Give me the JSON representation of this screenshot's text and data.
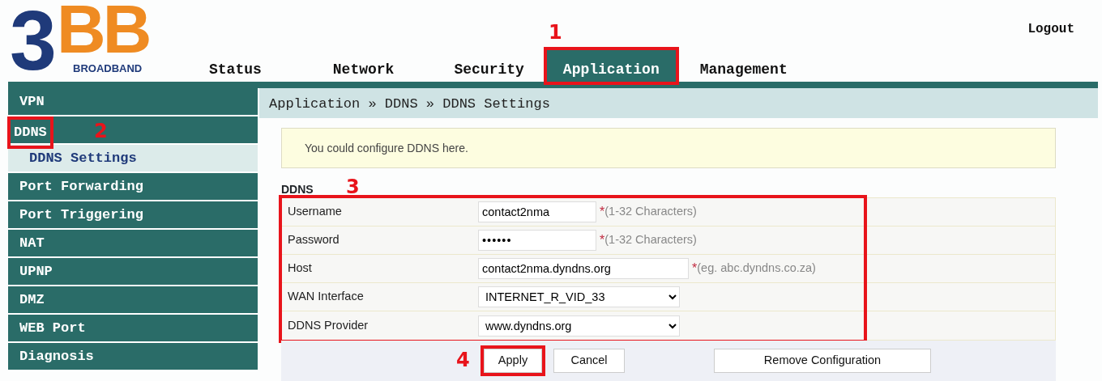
{
  "logo": {
    "numeral": "3",
    "letters": "BB",
    "tagline": "BROADBAND"
  },
  "logout": "Logout",
  "tabs": [
    {
      "label": "Status",
      "selected": false
    },
    {
      "label": "Network",
      "selected": false
    },
    {
      "label": "Security",
      "selected": false
    },
    {
      "label": "Application",
      "selected": true,
      "callout": "1"
    },
    {
      "label": "Management",
      "selected": false
    }
  ],
  "sidebar": {
    "items": [
      {
        "label": "VPN"
      },
      {
        "label": "DDNS",
        "callout": "2",
        "children": [
          {
            "label": "DDNS Settings",
            "selected": true
          }
        ]
      },
      {
        "label": "Port Forwarding"
      },
      {
        "label": "Port Triggering"
      },
      {
        "label": "NAT"
      },
      {
        "label": "UPNP"
      },
      {
        "label": "DMZ"
      },
      {
        "label": "WEB Port"
      },
      {
        "label": "Diagnosis"
      }
    ]
  },
  "breadcrumb": "Application » DDNS » DDNS Settings",
  "info": "You could configure DDNS here.",
  "form": {
    "title": "DDNS",
    "callout": "3",
    "fields": [
      {
        "label": "Username",
        "kind": "text",
        "value": "contact2nma",
        "marker": "*",
        "hint": "(1-32 Characters)"
      },
      {
        "label": "Password",
        "kind": "password",
        "value": "••••••",
        "marker": "*",
        "hint": "(1-32 Characters)"
      },
      {
        "label": "Host",
        "kind": "wide",
        "value": "contact2nma.dyndns.org",
        "marker": "*",
        "hint": "(eg. abc.dyndns.co.za)"
      },
      {
        "label": "WAN Interface",
        "kind": "select",
        "value": "INTERNET_R_VID_33"
      },
      {
        "label": "DDNS Provider",
        "kind": "select",
        "value": "www.dyndns.org"
      }
    ]
  },
  "buttons": [
    {
      "label": "Apply",
      "kind": "apply",
      "callout": "4"
    },
    {
      "label": "Cancel",
      "kind": "cancel"
    },
    {
      "label": "Remove Configuration",
      "kind": "remove"
    }
  ]
}
